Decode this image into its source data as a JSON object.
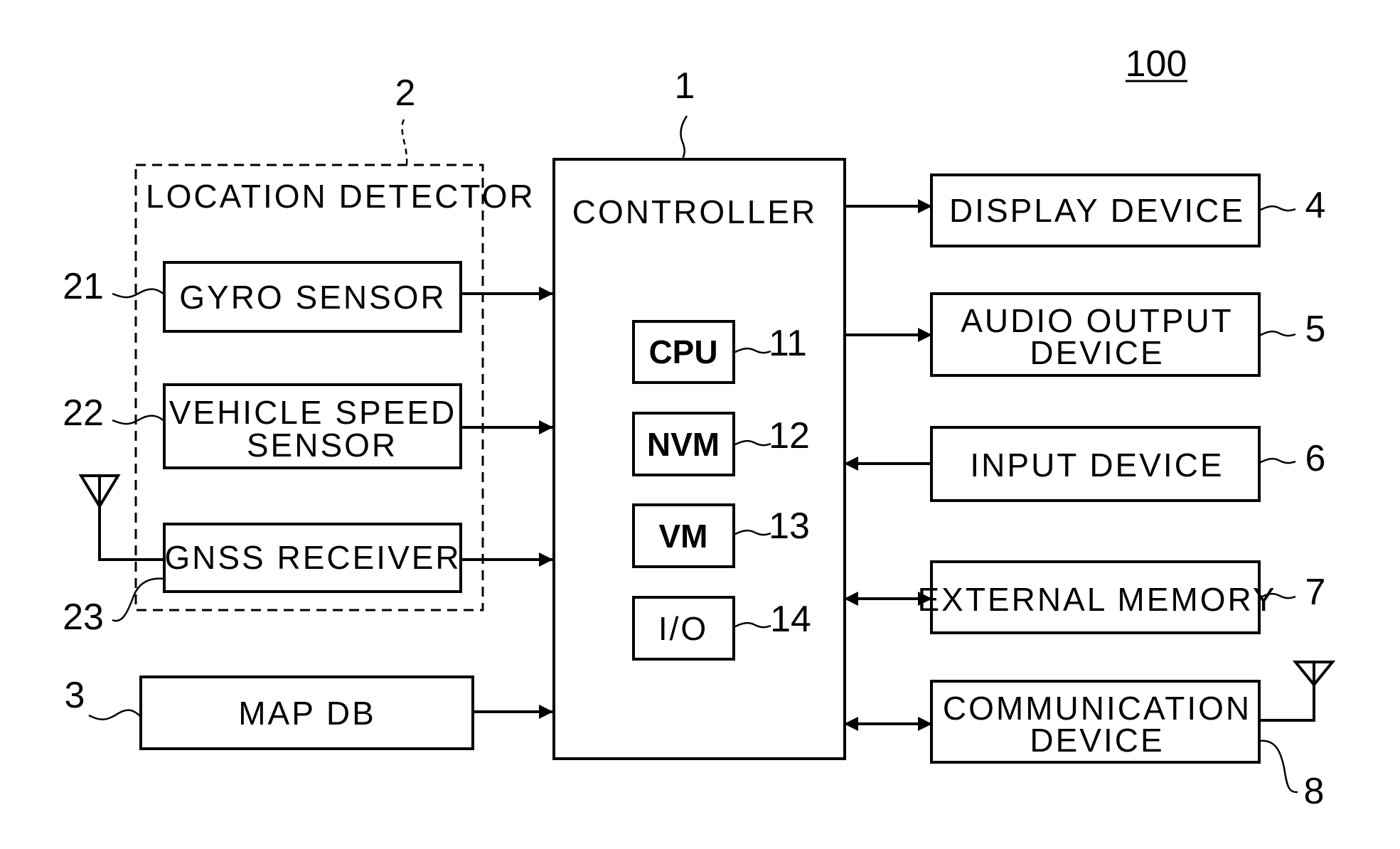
{
  "figure": {
    "system_ref": "100",
    "controller": {
      "ref": "1",
      "label": "CONTROLLER",
      "components": [
        {
          "label": "CPU",
          "ref": "11"
        },
        {
          "label": "NVM",
          "ref": "12"
        },
        {
          "label": "VM",
          "ref": "13"
        },
        {
          "label": "I/O",
          "ref": "14"
        }
      ]
    },
    "location_detector": {
      "ref": "2",
      "label": "LOCATION DETECTOR",
      "sensors": [
        {
          "label_lines": [
            "GYRO SENSOR"
          ],
          "ref": "21",
          "connection": "to-controller"
        },
        {
          "label_lines": [
            "VEHICLE SPEED",
            "SENSOR"
          ],
          "ref": "22",
          "connection": "to-controller"
        },
        {
          "label_lines": [
            "GNSS RECEIVER"
          ],
          "ref": "23",
          "connection": "to-controller",
          "has_antenna": true
        }
      ]
    },
    "map_db": {
      "label": "MAP DB",
      "ref": "3",
      "connection": "to-controller"
    },
    "peripherals": [
      {
        "label_lines": [
          "DISPLAY DEVICE"
        ],
        "ref": "4",
        "connection": "from-controller"
      },
      {
        "label_lines": [
          "AUDIO OUTPUT",
          "DEVICE"
        ],
        "ref": "5",
        "connection": "from-controller"
      },
      {
        "label_lines": [
          "INPUT DEVICE"
        ],
        "ref": "6",
        "connection": "to-controller"
      },
      {
        "label_lines": [
          "EXTERNAL MEMORY"
        ],
        "ref": "7",
        "connection": "bidirectional"
      },
      {
        "label_lines": [
          "COMMUNICATION",
          "DEVICE"
        ],
        "ref": "8",
        "connection": "bidirectional",
        "has_antenna": true
      }
    ]
  }
}
